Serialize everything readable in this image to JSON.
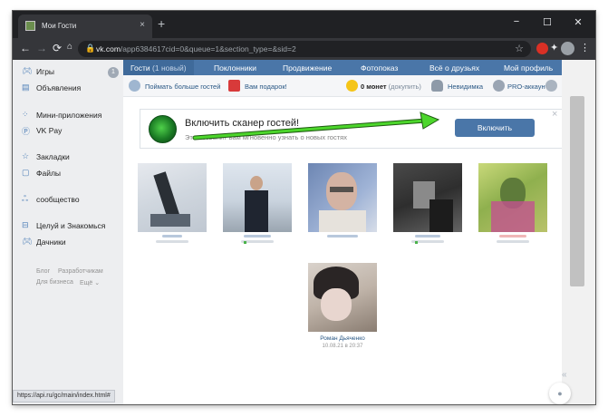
{
  "browser": {
    "tab_title": "Мои Гости",
    "tab_close": "×",
    "new_tab": "+",
    "url_host": "vk.com",
    "url_path": "/app6384617cid=0&queue=1&section_type=&sid=2",
    "status_url": "https://api.ru/gc/main/index.html#",
    "window_min": "−",
    "window_max": "☐",
    "window_close": "✕"
  },
  "sidebar": {
    "items": [
      {
        "label": "Игры",
        "icon": "gamepad-icon",
        "badge": "1"
      },
      {
        "label": "Объявления",
        "icon": "ads-icon"
      },
      {
        "label": "Мини-приложения",
        "icon": "apps-icon"
      },
      {
        "label": "VK Pay",
        "icon": "vkpay-icon"
      },
      {
        "label": "Закладки",
        "icon": "star-icon"
      },
      {
        "label": "Файлы",
        "icon": "file-icon"
      },
      {
        "label": "сообщество",
        "icon": "community-icon"
      },
      {
        "label": "Целуй и Знакомься",
        "icon": "bag-icon"
      },
      {
        "label": "Дачники",
        "icon": "gamepad-icon"
      }
    ],
    "footer": {
      "blog": "Блог",
      "devs": "Разработчикам",
      "business": "Для бизнеса",
      "more": "Ещё ⌄"
    }
  },
  "menu": {
    "guests": "Гости",
    "guests_count": "(1 новый)",
    "fans": "Поклонники",
    "promotion": "Продвижение",
    "photoshow": "Фотопоказ",
    "about_friends": "Всё о друзьях",
    "profile": "Мой профиль"
  },
  "toolbar": {
    "catch_guests": "Поймать больше гостей",
    "gift": "Вам подарок!",
    "coins": "0 монет",
    "topup": "(докупить)",
    "invisible": "Невидимка",
    "pro": "PRO-аккаунт"
  },
  "scanner": {
    "title": "Включить сканер гостей!",
    "subtitle": "Это позволит вам мгновенно узнать о новых гостях",
    "button": "Включить",
    "close": "×"
  },
  "guests": [
    {
      "name": "",
      "date": ""
    },
    {
      "name": "",
      "date": ""
    },
    {
      "name": "",
      "date": ""
    },
    {
      "name": "",
      "date": ""
    },
    {
      "name": "",
      "date": ""
    },
    {
      "name": "Роман Дьяченко",
      "date": "10.08.21 в 20:37"
    }
  ],
  "colors": {
    "vk_blue": "#4a76a8",
    "link": "#2a5885",
    "arrow_green": "#4cd62b"
  }
}
